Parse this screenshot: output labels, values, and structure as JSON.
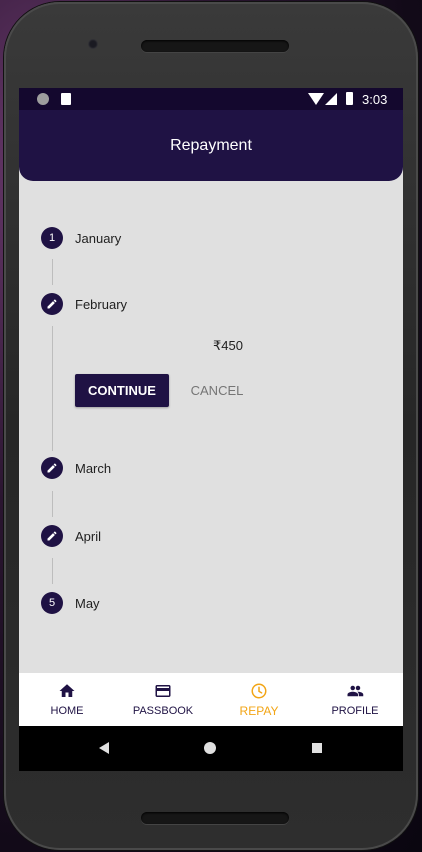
{
  "status_bar": {
    "time": "3:03"
  },
  "app_bar": {
    "title": "Repayment"
  },
  "steps": [
    {
      "number": "1",
      "label": "January",
      "icon": "number"
    },
    {
      "number": "",
      "label": "February",
      "icon": "pencil-icon"
    },
    {
      "number": "",
      "label": "March",
      "icon": "pencil-icon"
    },
    {
      "number": "",
      "label": "April",
      "icon": "pencil-icon"
    },
    {
      "number": "5",
      "label": "May",
      "icon": "number"
    }
  ],
  "active_step": {
    "amount": "₹450",
    "continue_label": "CONTINUE",
    "cancel_label": "CANCEL"
  },
  "bottom_nav": {
    "items": [
      {
        "label": "HOME",
        "icon": "home-icon"
      },
      {
        "label": "PASSBOOK",
        "icon": "card-icon"
      },
      {
        "label": "REPAY",
        "icon": "clock-icon",
        "active": true
      },
      {
        "label": "PROFILE",
        "icon": "people-icon"
      }
    ]
  },
  "colors": {
    "primary": "#1f1244",
    "accent": "#f2a516",
    "background": "#e0e0e0"
  }
}
